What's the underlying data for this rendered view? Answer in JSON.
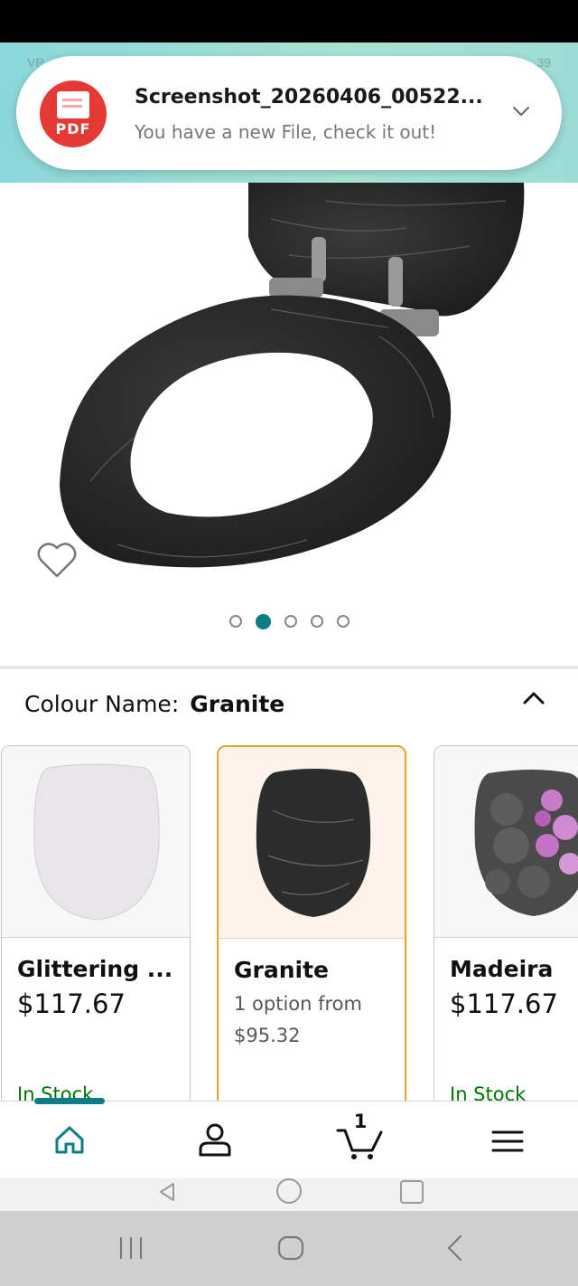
{
  "header": {
    "faded_left": "VP",
    "faded_right": "39"
  },
  "notification": {
    "app_icon": "pdf-icon",
    "app_icon_label": "PDF",
    "title": "Screenshot_20260406_00522...",
    "message": "You have a new File, check it out!"
  },
  "product": {
    "image": "black-granite-toilet-seat",
    "carousel": {
      "count": 5,
      "active": 2
    }
  },
  "colour": {
    "label": "Colour Name:",
    "value": "Granite"
  },
  "variants": [
    {
      "name": "Glittering ...",
      "price": "$117.67",
      "stock": "In Stock",
      "image": "white-glitter-seat"
    },
    {
      "name": "Granite",
      "option": "1 option from",
      "from_price": "$95.32",
      "selected": true,
      "image": "black-granite-seat"
    },
    {
      "name": "Madeira",
      "price": "$117.67",
      "stock": "In Stock",
      "image": "orchid-pebble-seat"
    }
  ],
  "bottom_nav": {
    "items": [
      "home-icon",
      "account-icon",
      "cart-icon",
      "menu-icon"
    ],
    "cart_count": "1",
    "active": "home"
  },
  "colors": {
    "accent": "#0e7c86",
    "selected_border": "#e3a62a",
    "in_stock": "#007600",
    "notification_red": "#e53935"
  }
}
